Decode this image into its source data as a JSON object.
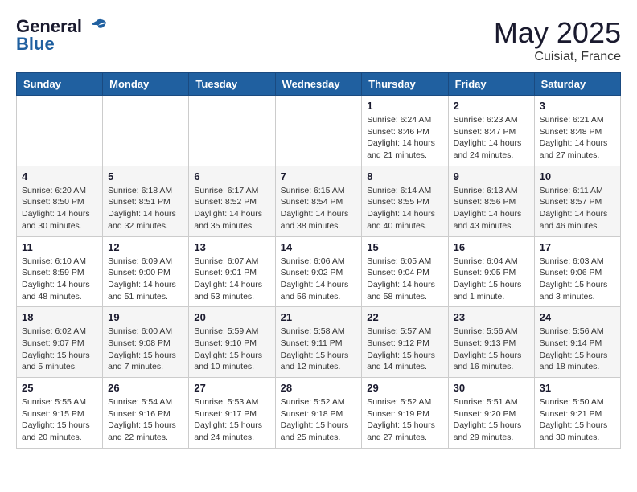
{
  "header": {
    "logo_general": "General",
    "logo_blue": "Blue",
    "month_year": "May 2025",
    "location": "Cuisiat, France"
  },
  "weekdays": [
    "Sunday",
    "Monday",
    "Tuesday",
    "Wednesday",
    "Thursday",
    "Friday",
    "Saturday"
  ],
  "weeks": [
    [
      {
        "day": "",
        "info": ""
      },
      {
        "day": "",
        "info": ""
      },
      {
        "day": "",
        "info": ""
      },
      {
        "day": "",
        "info": ""
      },
      {
        "day": "1",
        "info": "Sunrise: 6:24 AM\nSunset: 8:46 PM\nDaylight: 14 hours\nand 21 minutes."
      },
      {
        "day": "2",
        "info": "Sunrise: 6:23 AM\nSunset: 8:47 PM\nDaylight: 14 hours\nand 24 minutes."
      },
      {
        "day": "3",
        "info": "Sunrise: 6:21 AM\nSunset: 8:48 PM\nDaylight: 14 hours\nand 27 minutes."
      }
    ],
    [
      {
        "day": "4",
        "info": "Sunrise: 6:20 AM\nSunset: 8:50 PM\nDaylight: 14 hours\nand 30 minutes."
      },
      {
        "day": "5",
        "info": "Sunrise: 6:18 AM\nSunset: 8:51 PM\nDaylight: 14 hours\nand 32 minutes."
      },
      {
        "day": "6",
        "info": "Sunrise: 6:17 AM\nSunset: 8:52 PM\nDaylight: 14 hours\nand 35 minutes."
      },
      {
        "day": "7",
        "info": "Sunrise: 6:15 AM\nSunset: 8:54 PM\nDaylight: 14 hours\nand 38 minutes."
      },
      {
        "day": "8",
        "info": "Sunrise: 6:14 AM\nSunset: 8:55 PM\nDaylight: 14 hours\nand 40 minutes."
      },
      {
        "day": "9",
        "info": "Sunrise: 6:13 AM\nSunset: 8:56 PM\nDaylight: 14 hours\nand 43 minutes."
      },
      {
        "day": "10",
        "info": "Sunrise: 6:11 AM\nSunset: 8:57 PM\nDaylight: 14 hours\nand 46 minutes."
      }
    ],
    [
      {
        "day": "11",
        "info": "Sunrise: 6:10 AM\nSunset: 8:59 PM\nDaylight: 14 hours\nand 48 minutes."
      },
      {
        "day": "12",
        "info": "Sunrise: 6:09 AM\nSunset: 9:00 PM\nDaylight: 14 hours\nand 51 minutes."
      },
      {
        "day": "13",
        "info": "Sunrise: 6:07 AM\nSunset: 9:01 PM\nDaylight: 14 hours\nand 53 minutes."
      },
      {
        "day": "14",
        "info": "Sunrise: 6:06 AM\nSunset: 9:02 PM\nDaylight: 14 hours\nand 56 minutes."
      },
      {
        "day": "15",
        "info": "Sunrise: 6:05 AM\nSunset: 9:04 PM\nDaylight: 14 hours\nand 58 minutes."
      },
      {
        "day": "16",
        "info": "Sunrise: 6:04 AM\nSunset: 9:05 PM\nDaylight: 15 hours\nand 1 minute."
      },
      {
        "day": "17",
        "info": "Sunrise: 6:03 AM\nSunset: 9:06 PM\nDaylight: 15 hours\nand 3 minutes."
      }
    ],
    [
      {
        "day": "18",
        "info": "Sunrise: 6:02 AM\nSunset: 9:07 PM\nDaylight: 15 hours\nand 5 minutes."
      },
      {
        "day": "19",
        "info": "Sunrise: 6:00 AM\nSunset: 9:08 PM\nDaylight: 15 hours\nand 7 minutes."
      },
      {
        "day": "20",
        "info": "Sunrise: 5:59 AM\nSunset: 9:10 PM\nDaylight: 15 hours\nand 10 minutes."
      },
      {
        "day": "21",
        "info": "Sunrise: 5:58 AM\nSunset: 9:11 PM\nDaylight: 15 hours\nand 12 minutes."
      },
      {
        "day": "22",
        "info": "Sunrise: 5:57 AM\nSunset: 9:12 PM\nDaylight: 15 hours\nand 14 minutes."
      },
      {
        "day": "23",
        "info": "Sunrise: 5:56 AM\nSunset: 9:13 PM\nDaylight: 15 hours\nand 16 minutes."
      },
      {
        "day": "24",
        "info": "Sunrise: 5:56 AM\nSunset: 9:14 PM\nDaylight: 15 hours\nand 18 minutes."
      }
    ],
    [
      {
        "day": "25",
        "info": "Sunrise: 5:55 AM\nSunset: 9:15 PM\nDaylight: 15 hours\nand 20 minutes."
      },
      {
        "day": "26",
        "info": "Sunrise: 5:54 AM\nSunset: 9:16 PM\nDaylight: 15 hours\nand 22 minutes."
      },
      {
        "day": "27",
        "info": "Sunrise: 5:53 AM\nSunset: 9:17 PM\nDaylight: 15 hours\nand 24 minutes."
      },
      {
        "day": "28",
        "info": "Sunrise: 5:52 AM\nSunset: 9:18 PM\nDaylight: 15 hours\nand 25 minutes."
      },
      {
        "day": "29",
        "info": "Sunrise: 5:52 AM\nSunset: 9:19 PM\nDaylight: 15 hours\nand 27 minutes."
      },
      {
        "day": "30",
        "info": "Sunrise: 5:51 AM\nSunset: 9:20 PM\nDaylight: 15 hours\nand 29 minutes."
      },
      {
        "day": "31",
        "info": "Sunrise: 5:50 AM\nSunset: 9:21 PM\nDaylight: 15 hours\nand 30 minutes."
      }
    ]
  ]
}
